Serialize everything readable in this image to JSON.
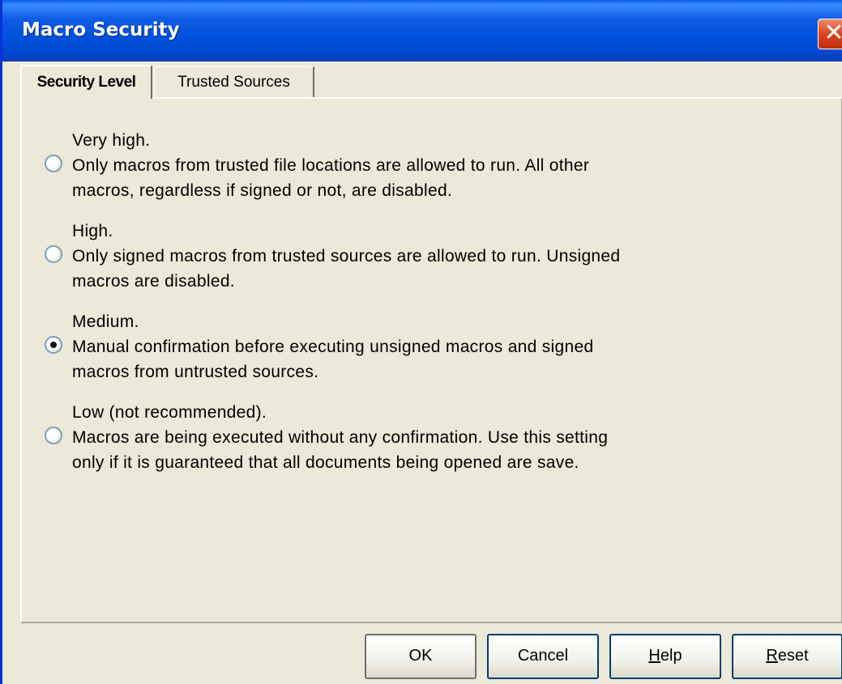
{
  "window": {
    "title": "Macro Security",
    "close_glyph": "✕"
  },
  "tabs": [
    {
      "label": "Security Level",
      "active": true
    },
    {
      "label": "Trusted Sources",
      "active": false
    }
  ],
  "options": [
    {
      "title": "Very high.",
      "lines": [
        "Only macros from trusted file locations are allowed to run. All other",
        "macros, regardless if signed or not, are disabled."
      ],
      "selected": false
    },
    {
      "title": "High.",
      "lines": [
        "Only signed macros from trusted sources are allowed to run. Unsigned",
        "macros are disabled."
      ],
      "selected": false
    },
    {
      "title": "Medium.",
      "lines": [
        "Manual confirmation before executing unsigned macros and signed",
        "macros from untrusted sources."
      ],
      "selected": true
    },
    {
      "title": "Low (not recommended).",
      "lines": [
        "Macros are being executed without any confirmation. Use this setting",
        "only if it is guaranteed that all  documents being opened are save."
      ],
      "selected": false
    }
  ],
  "buttons": {
    "ok": "OK",
    "cancel": "Cancel",
    "help_mnemonic": "H",
    "help_rest": "elp",
    "reset_mnemonic": "R",
    "reset_rest": "eset"
  },
  "colors": {
    "titlebar": "#0052dc",
    "dialog_bg": "#ece9d8",
    "close": "#d8401b"
  },
  "icons": {
    "close": "close-icon"
  }
}
